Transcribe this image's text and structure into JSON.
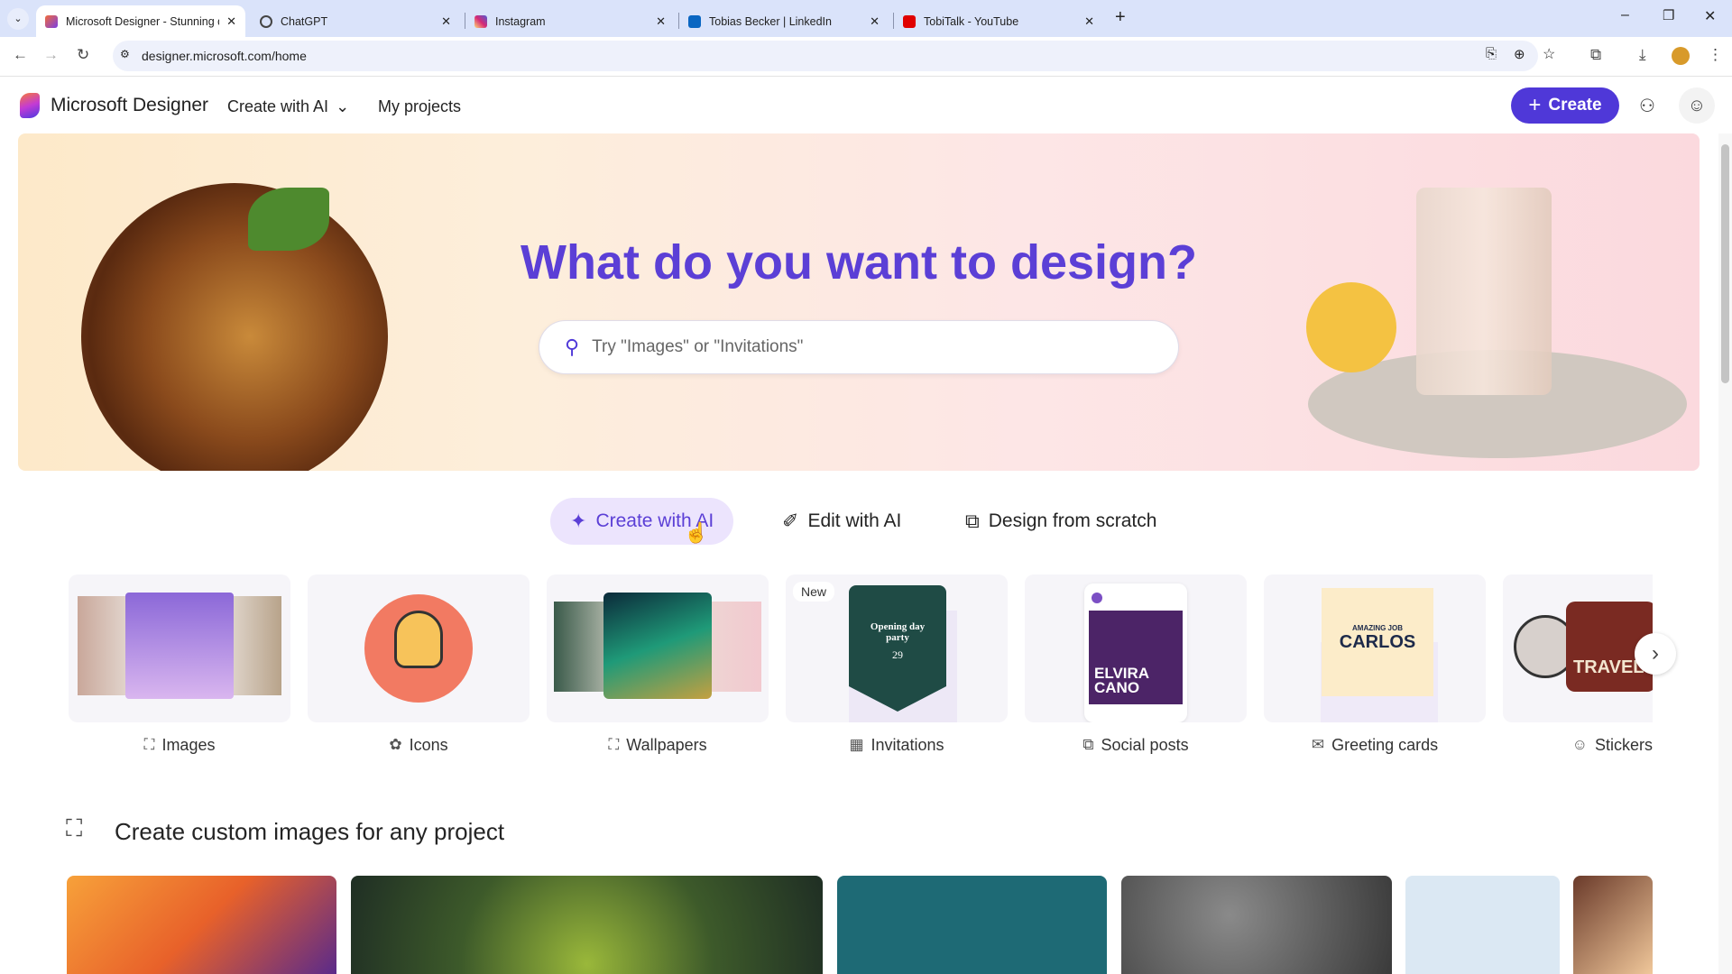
{
  "browser": {
    "tabs": [
      {
        "label": "Microsoft Designer - Stunning d",
        "active": true,
        "color": "#7b3fe4"
      },
      {
        "label": "ChatGPT",
        "color": "#444444"
      },
      {
        "label": "Instagram",
        "color": "#d62976"
      },
      {
        "label": "Tobias Becker | LinkedIn",
        "color": "#0a66c2"
      },
      {
        "label": "TobiTalk - YouTube",
        "color": "#e00000"
      }
    ],
    "url": "designer.microsoft.com/home"
  },
  "header": {
    "brand": "Microsoft Designer",
    "nav_create": "Create with AI",
    "nav_projects": "My projects",
    "create_button": "Create"
  },
  "hero": {
    "title": "What do you want to design?",
    "search_placeholder": "Try \"Images\" or \"Invitations\""
  },
  "modes": [
    {
      "label": "Create with AI",
      "active": true
    },
    {
      "label": "Edit with AI"
    },
    {
      "label": "Design from scratch"
    }
  ],
  "categories": [
    {
      "label": "Images",
      "icon": "image-sparkle-icon"
    },
    {
      "label": "Icons",
      "icon": "icons-icon"
    },
    {
      "label": "Wallpapers",
      "icon": "wallpaper-icon"
    },
    {
      "label": "Invitations",
      "icon": "calendar-icon",
      "badge": "New",
      "preview_title": "Opening day party",
      "preview_date": "29"
    },
    {
      "label": "Social posts",
      "icon": "shapes-icon",
      "preview_name": "ELVIRA CANO"
    },
    {
      "label": "Greeting cards",
      "icon": "mail-icon",
      "preview_top": "AMAZING JOB",
      "preview_name": "CARLOS"
    },
    {
      "label": "Stickers",
      "icon": "sticker-icon",
      "preview_text": "TRAVEL"
    }
  ],
  "section": {
    "title": "Create custom images for any project"
  },
  "accent": "#4f38d8"
}
